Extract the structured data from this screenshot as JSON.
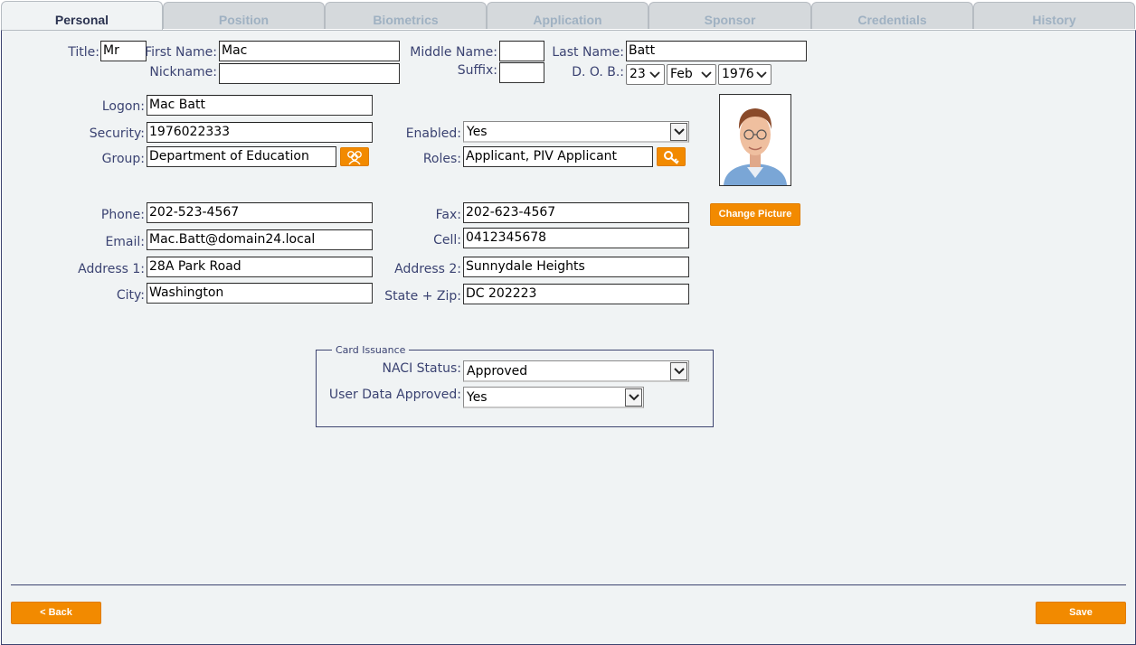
{
  "tabs": [
    "Personal",
    "Position",
    "Biometrics",
    "Application",
    "Sponsor",
    "Credentials",
    "History"
  ],
  "personal": {
    "title_label": "Title:",
    "title": "Mr",
    "first_name_label": "First Name:",
    "first_name": "Mac",
    "middle_name_label": "Middle Name:",
    "middle_name": "",
    "last_name_label": "Last Name:",
    "last_name": "Batt",
    "nickname_label": "Nickname:",
    "nickname": "",
    "suffix_label": "Suffix:",
    "suffix": "",
    "dob_label": "D. O. B.:",
    "dob_day": "23",
    "dob_month": "Feb",
    "dob_year": "1976"
  },
  "account": {
    "logon_label": "Logon:",
    "logon": "Mac Batt",
    "security_label": "Security:",
    "security": "1976022333",
    "group_label": "Group:",
    "group": "Department of Education",
    "enabled_label": "Enabled:",
    "enabled": "Yes",
    "roles_label": "Roles:",
    "roles": "Applicant, PIV Applicant",
    "change_picture": "Change Picture"
  },
  "contact": {
    "phone_label": "Phone:",
    "phone": "202-523-4567",
    "fax_label": "Fax:",
    "fax": "202-623-4567",
    "email_label": "Email:",
    "email": "Mac.Batt@domain24.local",
    "cell_label": "Cell:",
    "cell": "0412345678",
    "address1_label": "Address 1:",
    "address1": "28A Park Road",
    "address2_label": "Address 2:",
    "address2": "Sunnydale Heights",
    "city_label": "City:",
    "city": "Washington",
    "state_zip_label": "State + Zip:",
    "state_zip": "DC 202223"
  },
  "card_issuance": {
    "legend": "Card Issuance",
    "naci_label": "NACI Status:",
    "naci": "Approved",
    "user_data_label": "User Data Approved:",
    "user_data": "Yes"
  },
  "footer": {
    "back": "< Back",
    "save": "Save"
  },
  "colors": {
    "accent": "#f28a00",
    "label": "#3b4372",
    "panel": "#f0f3f4"
  }
}
